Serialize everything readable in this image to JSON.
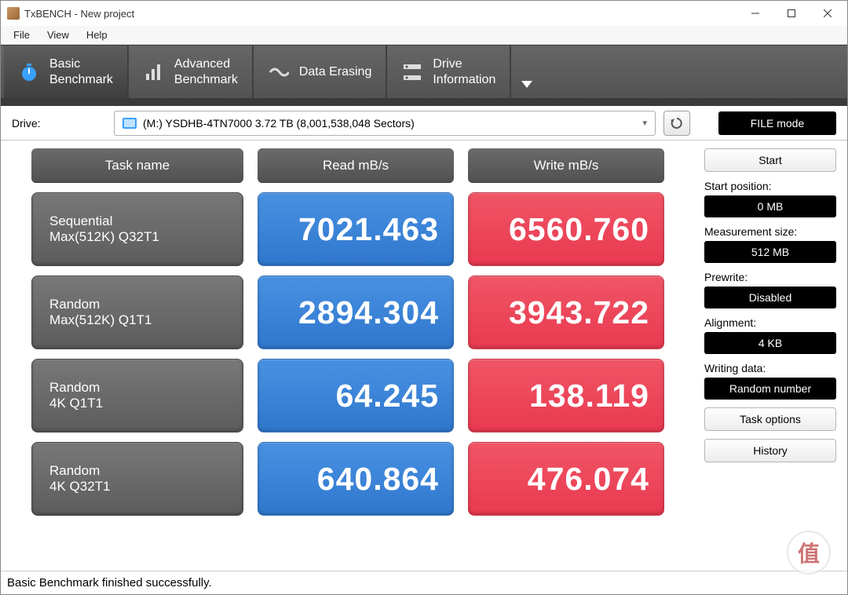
{
  "window": {
    "title": "TxBENCH - New project"
  },
  "menu": {
    "file": "File",
    "view": "View",
    "help": "Help"
  },
  "tabs": {
    "basic": {
      "l1": "Basic",
      "l2": "Benchmark"
    },
    "advanced": {
      "l1": "Advanced",
      "l2": "Benchmark"
    },
    "erasing": {
      "label": "Data Erasing"
    },
    "driveinfo": {
      "l1": "Drive",
      "l2": "Information"
    }
  },
  "drivebar": {
    "label": "Drive:",
    "selected": "(M:) YSDHB-4TN7000  3.72 TB (8,001,538,048 Sectors)"
  },
  "filemode_label": "FILE mode",
  "headers": {
    "task": "Task name",
    "read": "Read mB/s",
    "write": "Write mB/s"
  },
  "rows": [
    {
      "task_l1": "Sequential",
      "task_l2": "Max(512K) Q32T1",
      "read": "7021.463",
      "write": "6560.760"
    },
    {
      "task_l1": "Random",
      "task_l2": "Max(512K) Q1T1",
      "read": "2894.304",
      "write": "3943.722"
    },
    {
      "task_l1": "Random",
      "task_l2": "4K Q1T1",
      "read": "64.245",
      "write": "138.119"
    },
    {
      "task_l1": "Random",
      "task_l2": "4K Q32T1",
      "read": "640.864",
      "write": "476.074"
    }
  ],
  "sidebar": {
    "start": "Start",
    "params": [
      {
        "label": "Start position:",
        "value": "0 MB"
      },
      {
        "label": "Measurement size:",
        "value": "512 MB"
      },
      {
        "label": "Prewrite:",
        "value": "Disabled"
      },
      {
        "label": "Alignment:",
        "value": "4 KB"
      },
      {
        "label": "Writing data:",
        "value": "Random number"
      }
    ],
    "task_options": "Task options",
    "history": "History"
  },
  "status": "Basic Benchmark finished successfully.",
  "watermark": "值"
}
